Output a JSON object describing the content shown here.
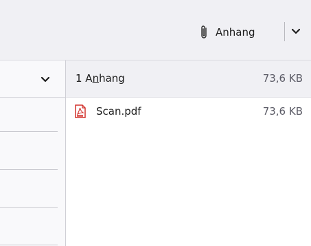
{
  "toolbar": {
    "attachment_button_label": "Anhang"
  },
  "attachments": {
    "count_prefix": "1 A",
    "count_mnemonic": "n",
    "count_suffix": "hang",
    "total_size": "73,6 KB",
    "files": [
      {
        "name": "Scan.pdf",
        "size": "73,6 KB",
        "icon": "pdf-file-icon"
      }
    ]
  },
  "colors": {
    "toolbar_bg": "#f0f0f4",
    "pdf_red": "#d2322d",
    "secondary_text": "#5b5b66"
  }
}
